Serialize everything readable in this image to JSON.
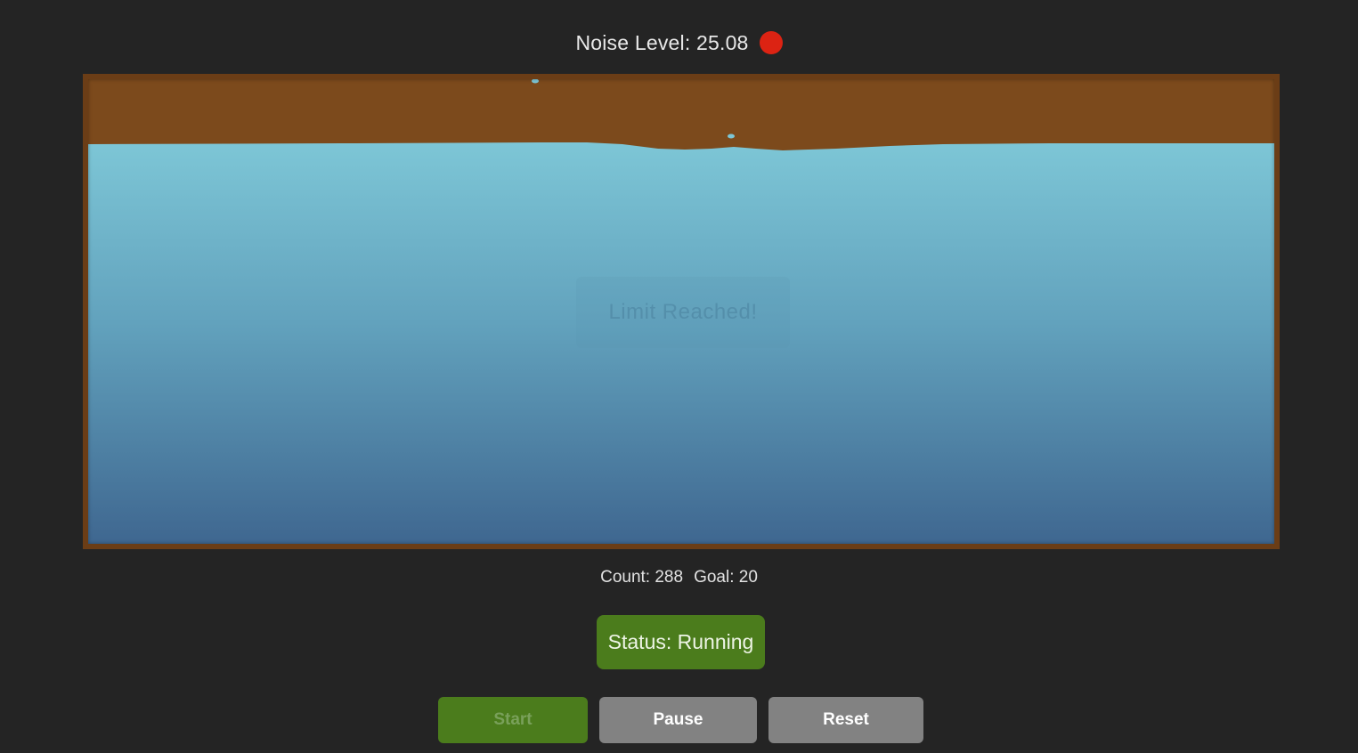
{
  "noise": {
    "label": "Noise Level: 25.08",
    "indicator_color": "#dc2313"
  },
  "tank": {
    "frame_color": "#6b3d16",
    "top_color": "#7c4a1c",
    "water_top_color": "#7dc6d6",
    "water_bottom_color": "#3f6790",
    "overlay_text": "Limit Reached!"
  },
  "counts": {
    "count_label": "Count: 288",
    "goal_label": "Goal: 20"
  },
  "status": {
    "label": "Status: Running",
    "color": "#4b7c1c"
  },
  "controls": {
    "start_label": "Start",
    "pause_label": "Pause",
    "reset_label": "Reset"
  }
}
